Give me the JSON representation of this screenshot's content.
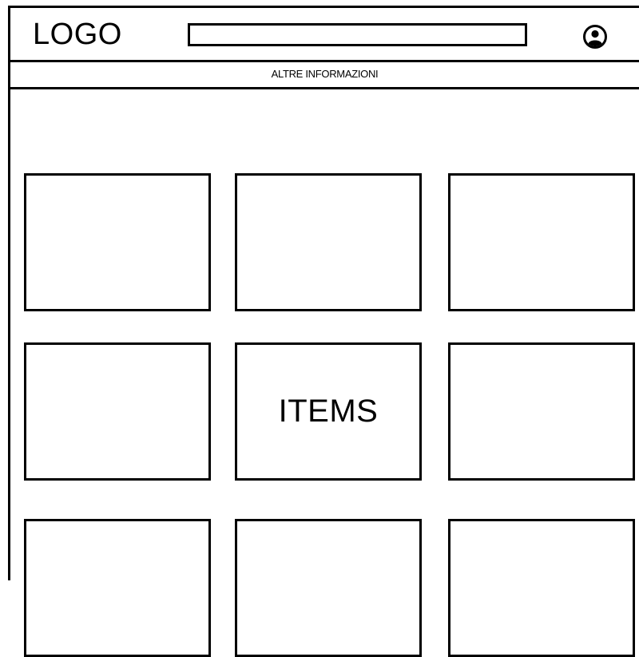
{
  "header": {
    "logo": "LOGO",
    "search": {
      "value": "",
      "placeholder": ""
    },
    "account_icon": "user-circle-icon"
  },
  "info_bar": {
    "label": "ALTRE INFORMAZIONI"
  },
  "grid": {
    "columns": 3,
    "rows_visible": 3,
    "items": [
      {
        "label": ""
      },
      {
        "label": ""
      },
      {
        "label": ""
      },
      {
        "label": ""
      },
      {
        "label": "ITEMS"
      },
      {
        "label": ""
      },
      {
        "label": ""
      },
      {
        "label": ""
      },
      {
        "label": ""
      }
    ]
  }
}
